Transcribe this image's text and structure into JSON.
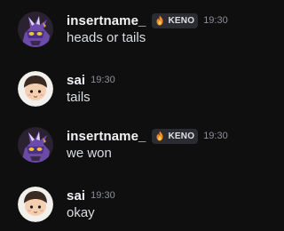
{
  "messages": [
    {
      "username": "insertname_",
      "tag": "KENO",
      "time": "19:30",
      "text": "heads or tails"
    },
    {
      "username": "sai",
      "time": "19:30",
      "text": "tails"
    },
    {
      "username": "insertname_",
      "tag": "KENO",
      "time": "19:30",
      "text": "we won"
    },
    {
      "username": "sai",
      "time": "19:30",
      "text": "okay"
    }
  ],
  "icons": {
    "tag_icon": "flame-icon",
    "avatar_1": "purple-dragon-avatar",
    "avatar_2": "round-face-avatar"
  },
  "colors": {
    "background": "#0f0f10",
    "username": "#f2f3f5",
    "message_text": "#dbdee1",
    "timestamp": "#8d9097",
    "tag_background": "#2b2c31"
  }
}
